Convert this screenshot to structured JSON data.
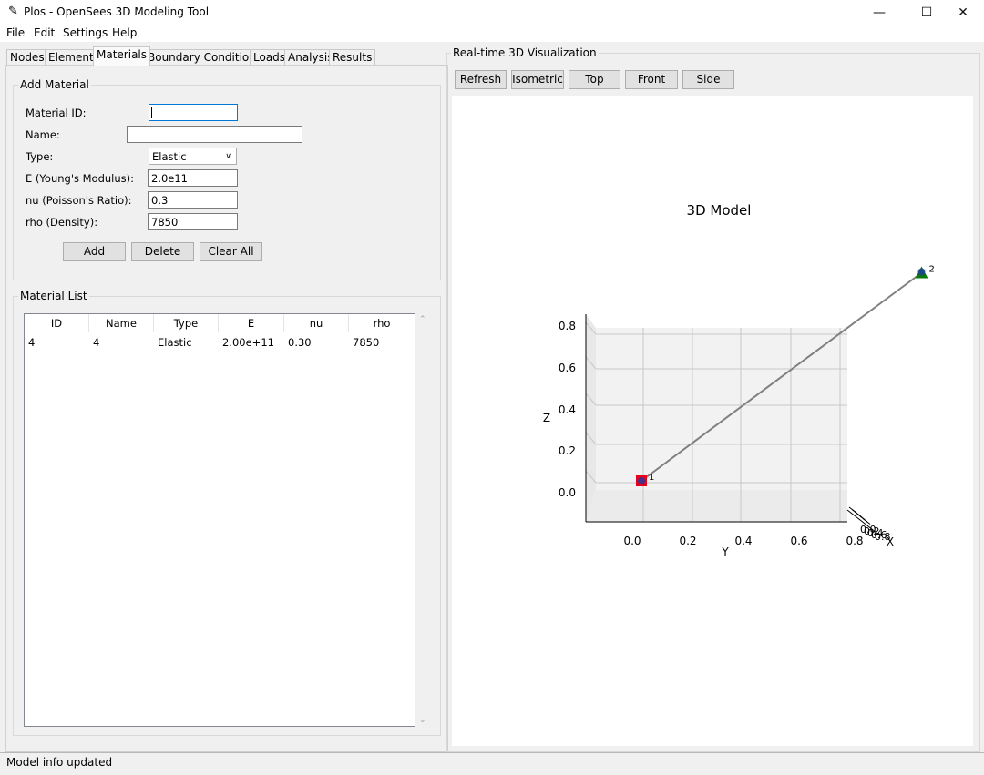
{
  "window": {
    "title": "Plos - OpenSees 3D Modeling Tool",
    "min_glyph": "—",
    "max_glyph": "☐",
    "close_glyph": "✕"
  },
  "menu": [
    "File",
    "Edit",
    "Settings",
    "Help"
  ],
  "tabs": [
    "Nodes",
    "Elements",
    "Materials",
    "Boundary Conditions",
    "Loads",
    "Analysis",
    "Results"
  ],
  "active_tab": "Materials",
  "add_material": {
    "title": "Add Material",
    "fields": {
      "material_id": {
        "label": "Material ID:",
        "value": ""
      },
      "name": {
        "label": "Name:",
        "value": ""
      },
      "type": {
        "label": "Type:",
        "value": "Elastic"
      },
      "E": {
        "label": "E (Young's Modulus):",
        "value": "2.0e11"
      },
      "nu": {
        "label": "nu (Poisson's Ratio):",
        "value": "0.3"
      },
      "rho": {
        "label": "rho (Density):",
        "value": "7850"
      }
    },
    "buttons": {
      "add": "Add",
      "delete": "Delete",
      "clear_all": "Clear All"
    }
  },
  "material_list": {
    "title": "Material List",
    "columns": [
      "ID",
      "Name",
      "Type",
      "E",
      "nu",
      "rho"
    ],
    "rows": [
      [
        "4",
        "4",
        "Elastic",
        "2.00e+11",
        "0.30",
        "7850"
      ]
    ]
  },
  "visualization": {
    "title": "Real-time 3D Visualization",
    "buttons": {
      "refresh": "Refresh",
      "isometric": "Isometric",
      "top": "Top",
      "front": "Front",
      "side": "Side"
    }
  },
  "chart_data": {
    "type": "line",
    "title": "3D Model",
    "xlabel": "X",
    "ylabel": "Y",
    "zlabel": "Z",
    "y_ticks": [
      "0.0",
      "0.2",
      "0.4",
      "0.6",
      "0.8"
    ],
    "z_ticks": [
      "0.0",
      "0.2",
      "0.4",
      "0.6",
      "0.8"
    ],
    "x_ticks": [
      "0.0",
      "0.2",
      "0.4",
      "0.6",
      "0.8"
    ],
    "nodes": [
      {
        "label": "1",
        "x": 0,
        "y": 0,
        "z": 0,
        "marker": "square",
        "color": "#e8001c"
      },
      {
        "label": "2",
        "x": 1,
        "y": 1,
        "z": 1,
        "marker": "triangle",
        "color": "#0a7a0a"
      }
    ],
    "elements": [
      {
        "from": "1",
        "to": "2",
        "color": "#808080"
      }
    ],
    "grid": true
  },
  "status": "Model info updated"
}
